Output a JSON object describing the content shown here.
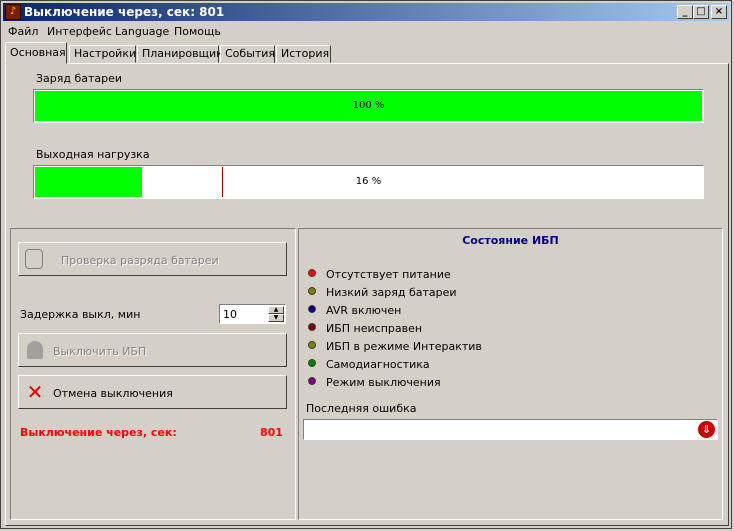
{
  "window": {
    "title": "Выключение через, сек: 801",
    "app_icon": "app-icon",
    "minimize_label": "_",
    "maximize_label": "□",
    "close_label": "×"
  },
  "menu": [
    "Файл",
    "Интерфейс",
    "Language",
    "Помощь"
  ],
  "tabs": [
    "Основная",
    "Настройки",
    "Планировщик",
    "События",
    "История"
  ],
  "battery": {
    "label": "Заряд батареи",
    "value_text": "100 %",
    "value": 100,
    "color": "#00ff00"
  },
  "load": {
    "label": "Выходная нагрузка",
    "value_text": "16 %",
    "value": 16,
    "color": "#00ff00",
    "threshold_color": "#a00000"
  },
  "controls": {
    "battery_test_label": "Проверка разряда батареи",
    "delay_label": "Задержка выкл, мин",
    "delay_value": "10",
    "shutdown_label": "Выключить ИБП",
    "cancel_label": "Отмена выключения",
    "countdown_label": "Выключение через, сек:",
    "countdown_value": "801",
    "countdown_color": "#ff0000"
  },
  "status": {
    "title": "Состояние ИБП",
    "title_color": "#000080",
    "items": [
      {
        "label": "Отсутствует питание",
        "color": "#ff0000"
      },
      {
        "label": "Низкий заряд батареи",
        "color": "#808000"
      },
      {
        "label": "AVR включен",
        "color": "#000080"
      },
      {
        "label": "ИБП неисправен",
        "color": "#800000"
      },
      {
        "label": "ИБП в режиме Интерактив",
        "color": "#808000"
      },
      {
        "label": "Самодиагностика",
        "color": "#008000"
      },
      {
        "label": "Режим выключения",
        "color": "#800080"
      }
    ],
    "last_error_label": "Последняя ошибка",
    "last_error_value": ""
  }
}
